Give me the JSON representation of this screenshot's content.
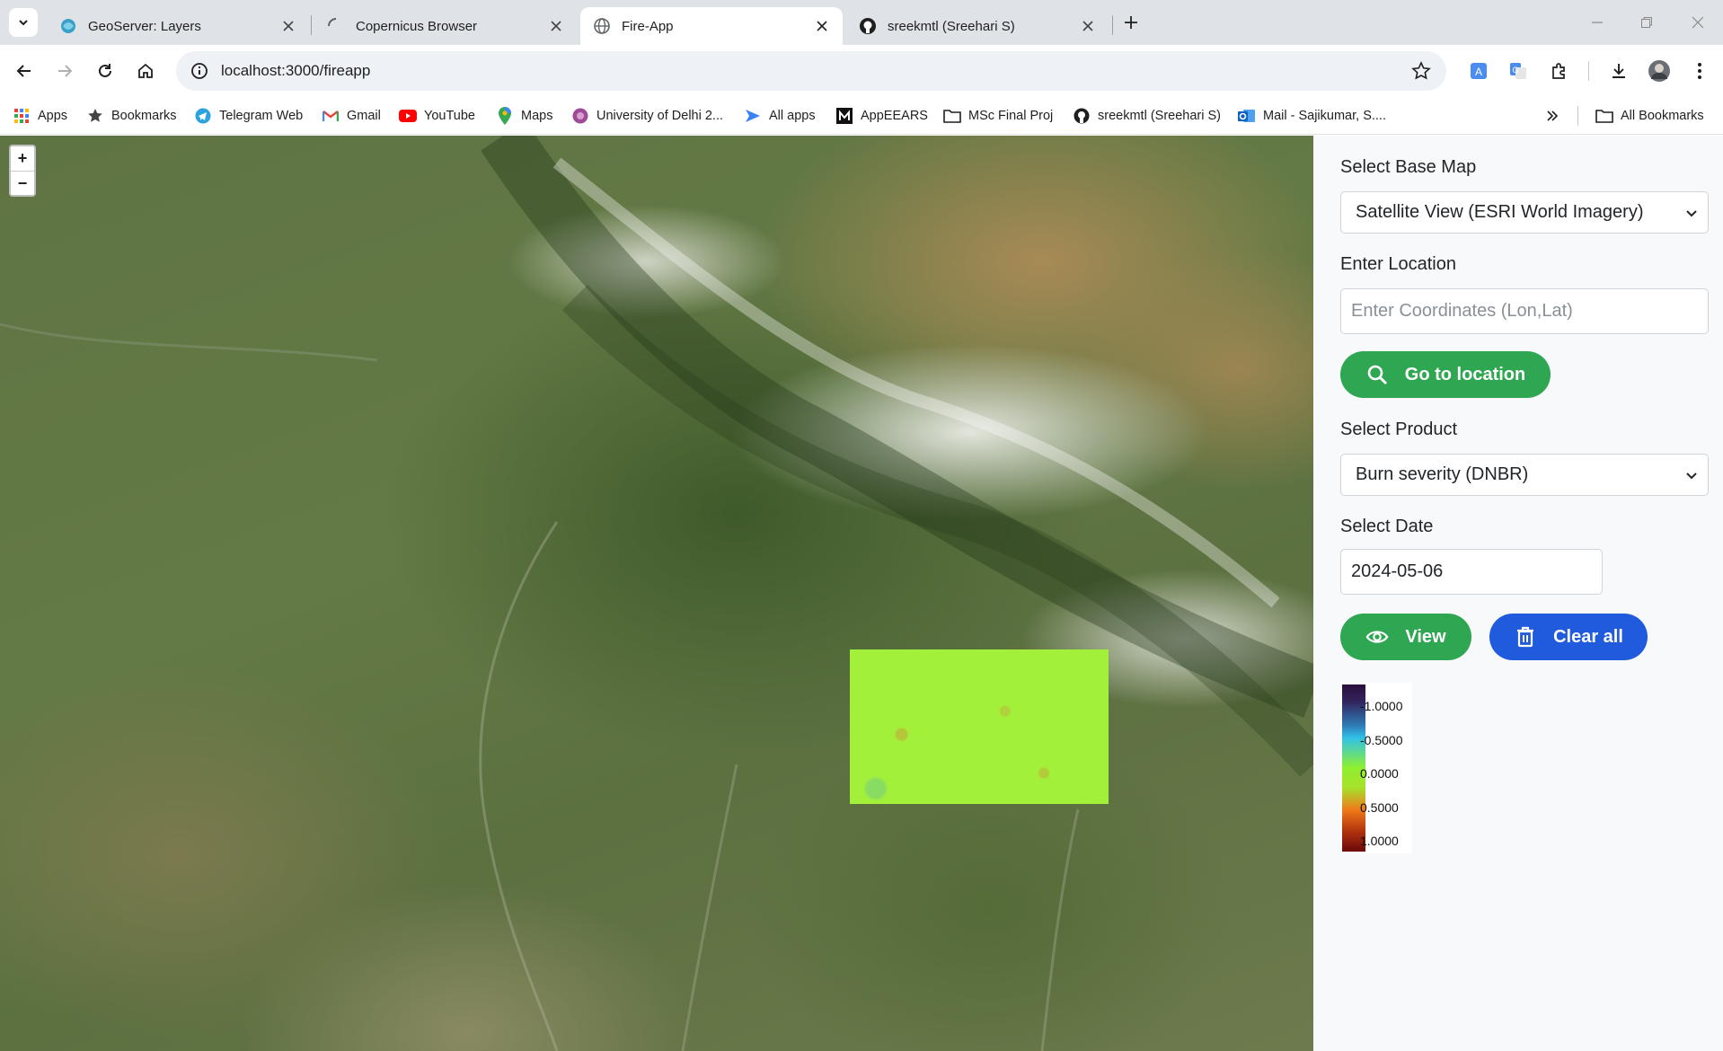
{
  "browser": {
    "tabs": [
      {
        "title": "GeoServer: Layers",
        "active": false
      },
      {
        "title": "Copernicus Browser",
        "active": false
      },
      {
        "title": "Fire-App",
        "active": true
      },
      {
        "title": "sreekmtl (Sreehari S)",
        "active": false
      }
    ],
    "url": "localhost:3000/fireapp",
    "bookmarks": [
      {
        "label": "Apps",
        "icon": "apps-grid-icon"
      },
      {
        "label": "Bookmarks",
        "icon": "star-icon"
      },
      {
        "label": "Telegram Web",
        "icon": "telegram-icon"
      },
      {
        "label": "Gmail",
        "icon": "gmail-icon"
      },
      {
        "label": "YouTube",
        "icon": "youtube-icon"
      },
      {
        "label": "Maps",
        "icon": "maps-pin-icon"
      },
      {
        "label": "University of Delhi 2...",
        "icon": "university-icon"
      },
      {
        "label": "All apps",
        "icon": "all-apps-icon"
      },
      {
        "label": "AppEEARS",
        "icon": "appeears-icon"
      },
      {
        "label": "MSc Final Proj",
        "icon": "folder-icon"
      },
      {
        "label": "sreekmtl (Sreehari S)",
        "icon": "github-icon"
      },
      {
        "label": "Mail - Sajikumar, S....",
        "icon": "outlook-icon"
      }
    ],
    "all_bookmarks_label": "All Bookmarks"
  },
  "map": {
    "zoom_in": "+",
    "zoom_out": "−"
  },
  "panel": {
    "base_map_label": "Select Base Map",
    "base_map_value": "Satellite View (ESRI World Imagery)",
    "location_label": "Enter Location",
    "location_placeholder": "Enter Coordinates (Lon,Lat)",
    "go_button": "Go to location",
    "product_label": "Select Product",
    "product_value": "Burn severity (DNBR)",
    "date_label": "Select Date",
    "date_value": "2024-05-06",
    "view_button": "View",
    "clear_button": "Clear all",
    "legend_ticks": [
      "-1.0000",
      "-0.5000",
      "0.0000",
      "0.5000",
      "1.0000"
    ]
  },
  "colors": {
    "accent_green": "#2fa652",
    "accent_blue": "#1f5bdc",
    "overlay_fill": "#a2f03a"
  }
}
